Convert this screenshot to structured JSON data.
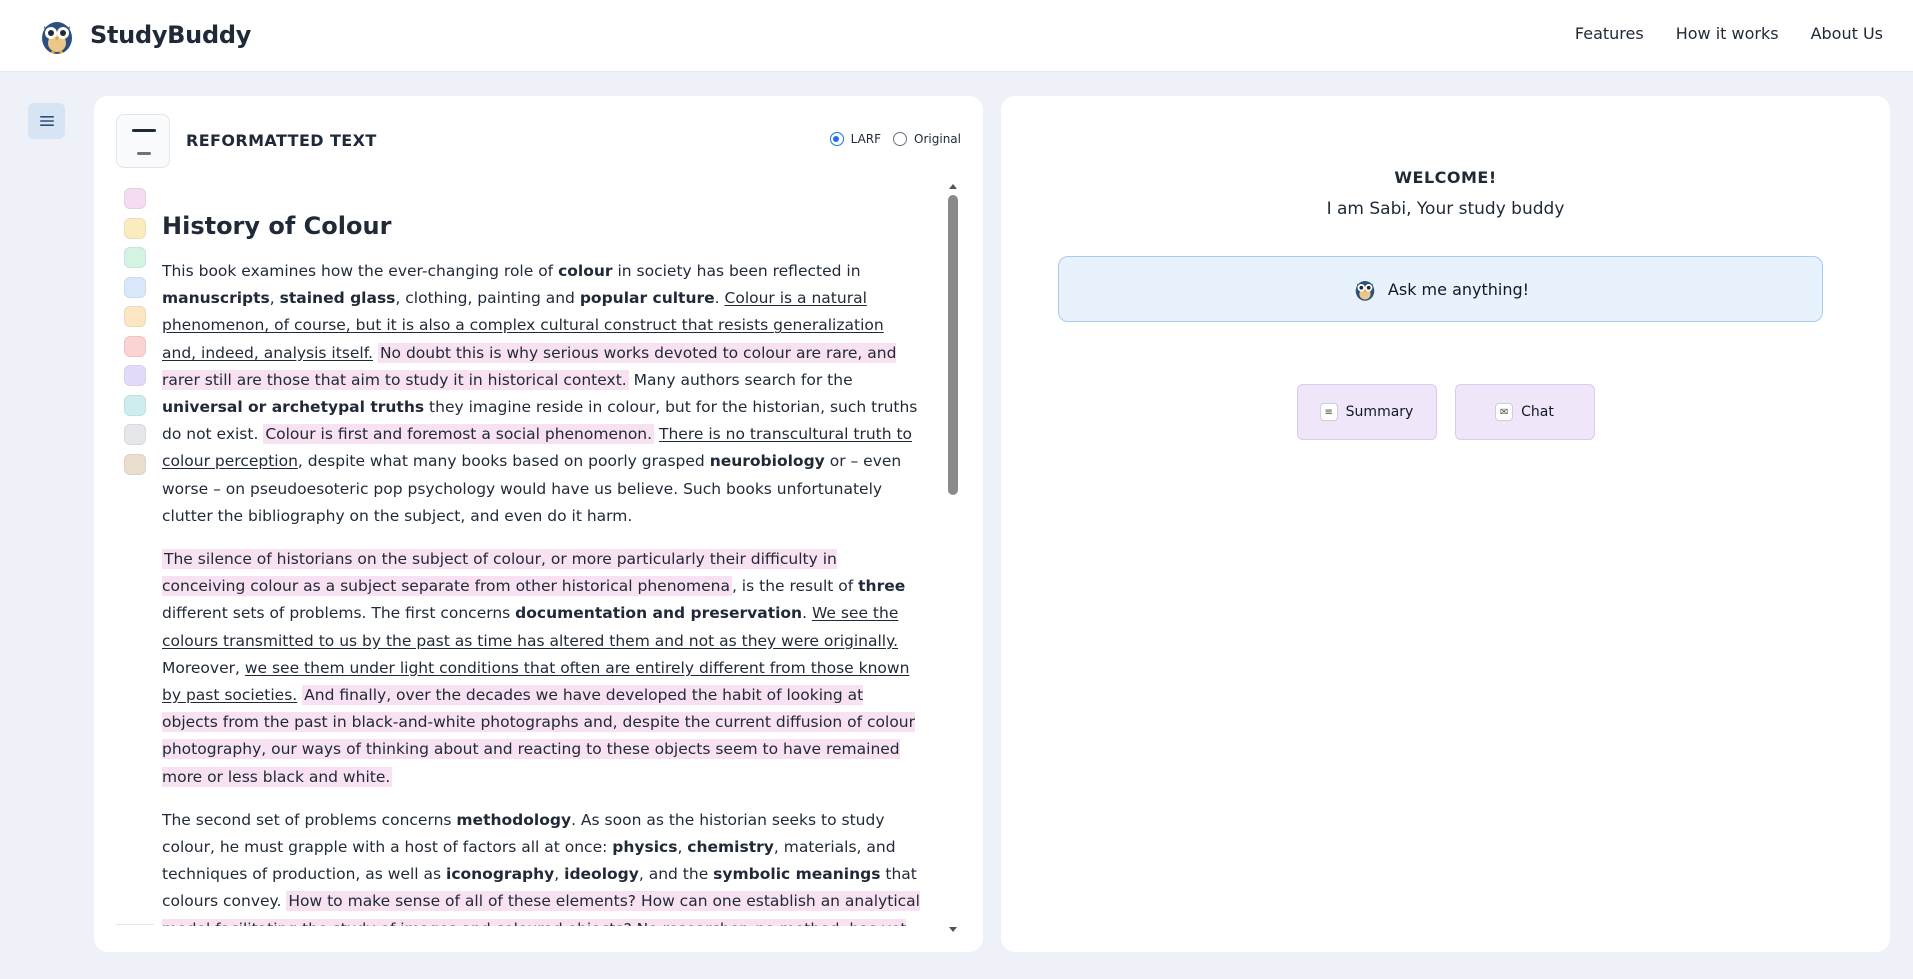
{
  "header": {
    "brand": "StudyBuddy",
    "nav": [
      "Features",
      "How it works",
      "About Us"
    ]
  },
  "left_panel": {
    "title": "REFORMATTED TEXT",
    "radio_larf": "LARF",
    "radio_original": "Original",
    "selected_mode": "LARF",
    "swatch_colors": [
      "#f5dcf2",
      "#fbecc0",
      "#d4f3e2",
      "#d9e8fb",
      "#fde6c4",
      "#fbd3d3",
      "#e4dbfa",
      "#cdeeec",
      "#e5e7eb",
      "#eadfcf"
    ],
    "doc_title": "History of Colour"
  },
  "right_panel": {
    "welcome": "WELCOME!",
    "subtitle": "I am Sabi, Your study buddy",
    "ask_label": "Ask me anything!",
    "summary_label": "Summary",
    "chat_label": "Chat"
  }
}
